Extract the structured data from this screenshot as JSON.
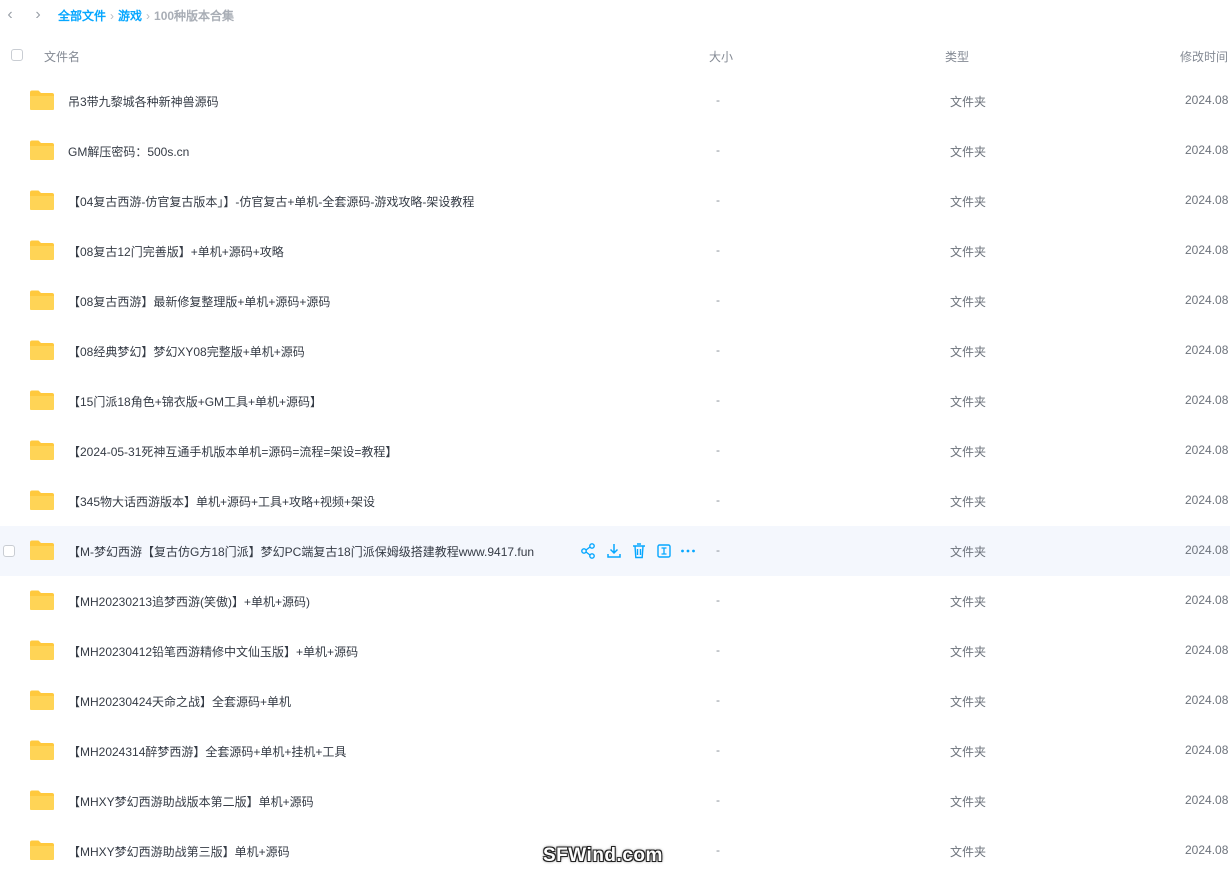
{
  "breadcrumb": {
    "items": [
      "全部文件",
      "游戏"
    ],
    "current": "100种版本合集"
  },
  "header": {
    "name": "文件名",
    "size": "大小",
    "type": "类型",
    "modified": "修改时间"
  },
  "rows": [
    {
      "name": "吊3带九黎城各种新神兽源码",
      "size": "-",
      "type": "文件夹",
      "modified": "2024.08"
    },
    {
      "name": "GM解压密码：500s.cn",
      "size": "-",
      "type": "文件夹",
      "modified": "2024.08"
    },
    {
      "name": "【04复古西游-仿官复古版本」】-仿官复古+单机-全套源码-游戏攻略-架设教程",
      "size": "-",
      "type": "文件夹",
      "modified": "2024.08"
    },
    {
      "name": "【08复古12门完善版】+单机+源码+攻略",
      "size": "-",
      "type": "文件夹",
      "modified": "2024.08"
    },
    {
      "name": "【08复古西游】最新修复整理版+单机+源码+源码",
      "size": "-",
      "type": "文件夹",
      "modified": "2024.08"
    },
    {
      "name": "【08经典梦幻】梦幻XY08完整版+单机+源码",
      "size": "-",
      "type": "文件夹",
      "modified": "2024.08"
    },
    {
      "name": "【15门派18角色+锦衣版+GM工具+单机+源码】",
      "size": "-",
      "type": "文件夹",
      "modified": "2024.08"
    },
    {
      "name": "【2024-05-31死神互通手机版本单机=源码=流程=架设=教程】",
      "size": "-",
      "type": "文件夹",
      "modified": "2024.08"
    },
    {
      "name": "【345物大话西游版本】单机+源码+工具+攻略+视频+架设",
      "size": "-",
      "type": "文件夹",
      "modified": "2024.08"
    },
    {
      "name": "【M-梦幻西游【复古仿G方18门派】梦幻PC端复古18门派保姆级搭建教程www.9417.fun",
      "size": "-",
      "type": "文件夹",
      "modified": "2024.08"
    },
    {
      "name": "【MH20230213追梦西游(笑傲)】+单机+源码)",
      "size": "-",
      "type": "文件夹",
      "modified": "2024.08"
    },
    {
      "name": "【MH20230412铅笔西游精修中文仙玉版】+单机+源码",
      "size": "-",
      "type": "文件夹",
      "modified": "2024.08"
    },
    {
      "name": "【MH20230424天命之战】全套源码+单机",
      "size": "-",
      "type": "文件夹",
      "modified": "2024.08"
    },
    {
      "name": "【MH2024314醉梦西游】全套源码+单机+挂机+工具",
      "size": "-",
      "type": "文件夹",
      "modified": "2024.08"
    },
    {
      "name": "【MHXY梦幻西游助战版本第二版】单机+源码",
      "size": "-",
      "type": "文件夹",
      "modified": "2024.08"
    },
    {
      "name": "【MHXY梦幻西游助战第三版】单机+源码",
      "size": "-",
      "type": "文件夹",
      "modified": "2024.08"
    }
  ],
  "hover_actions": [
    "share-icon",
    "download-icon",
    "delete-icon",
    "rename-icon",
    "more-icon"
  ],
  "watermark": "SFWind.com",
  "colors": {
    "accent": "#06a7ff",
    "folder": "#ffc93d",
    "hover_row": "#f4f7fd"
  }
}
